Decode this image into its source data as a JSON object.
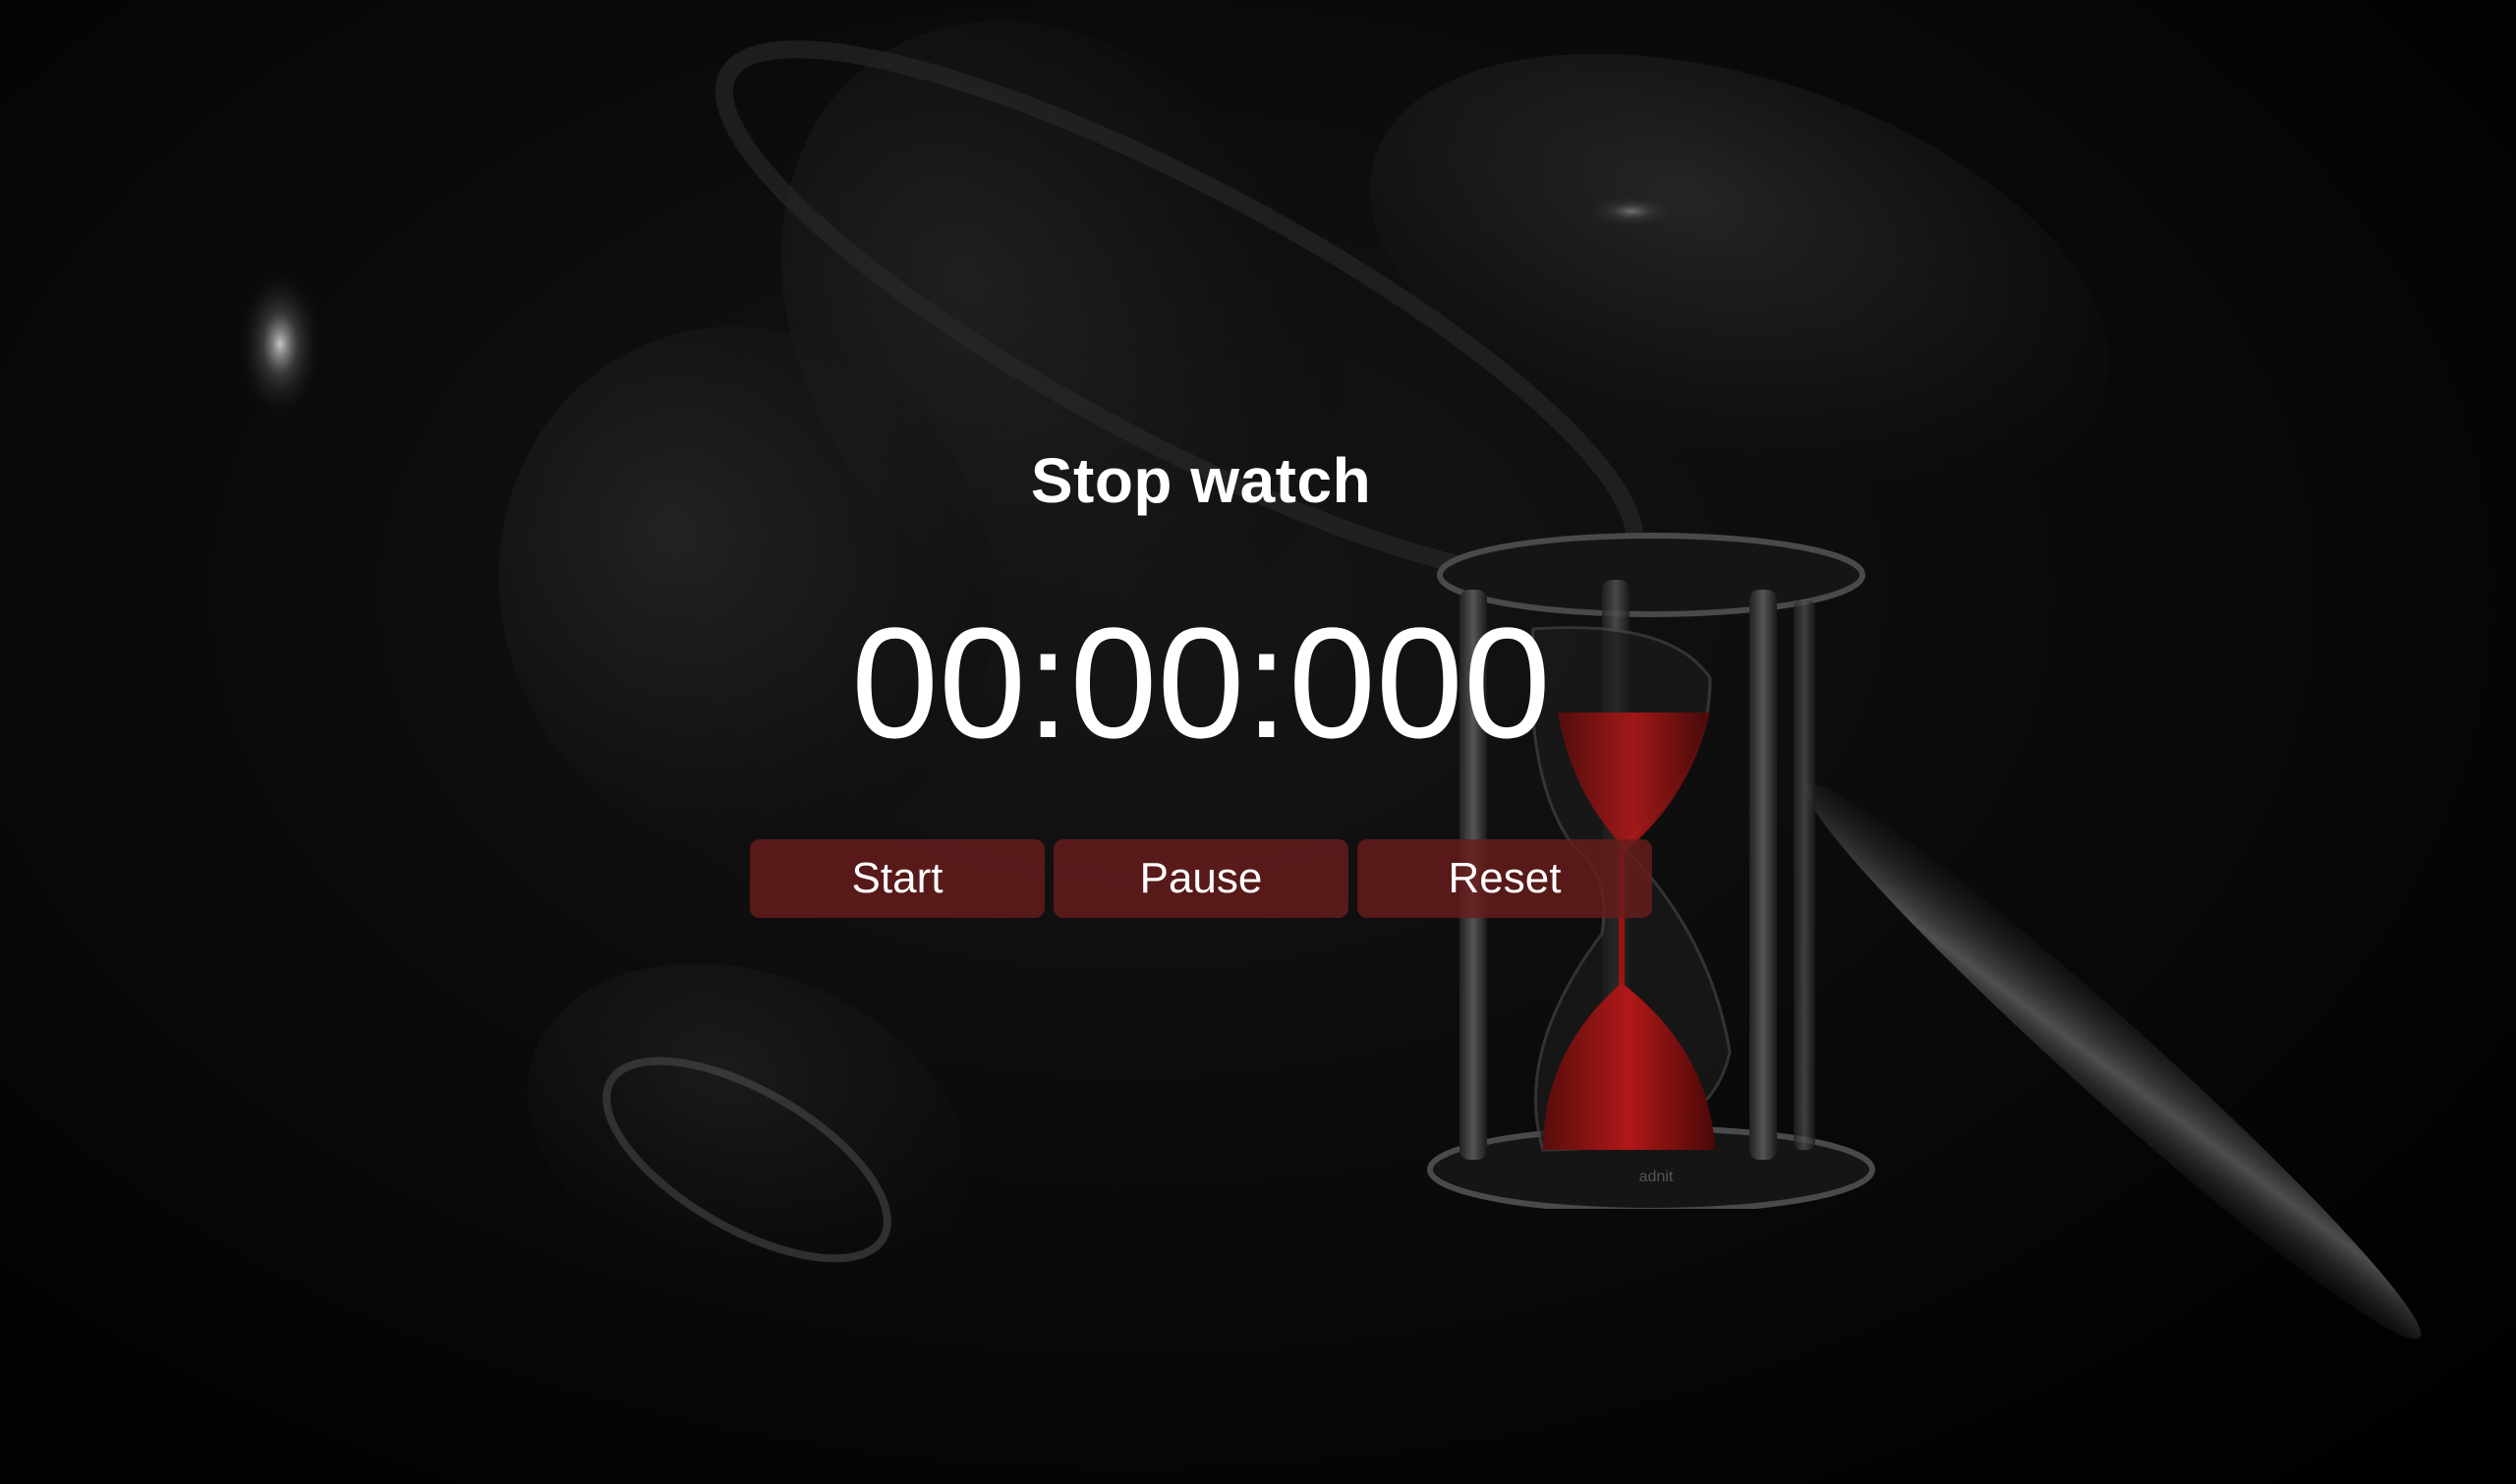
{
  "app": {
    "title": "Stop watch",
    "time_display": "00:00:000"
  },
  "controls": {
    "start_label": "Start",
    "pause_label": "Pause",
    "reset_label": "Reset"
  },
  "theme": {
    "background": "#000000",
    "text": "#ffffff",
    "button": "#691c1c",
    "accent": "#b01818"
  },
  "decor": {
    "hourglass_engraving": "adnit"
  }
}
